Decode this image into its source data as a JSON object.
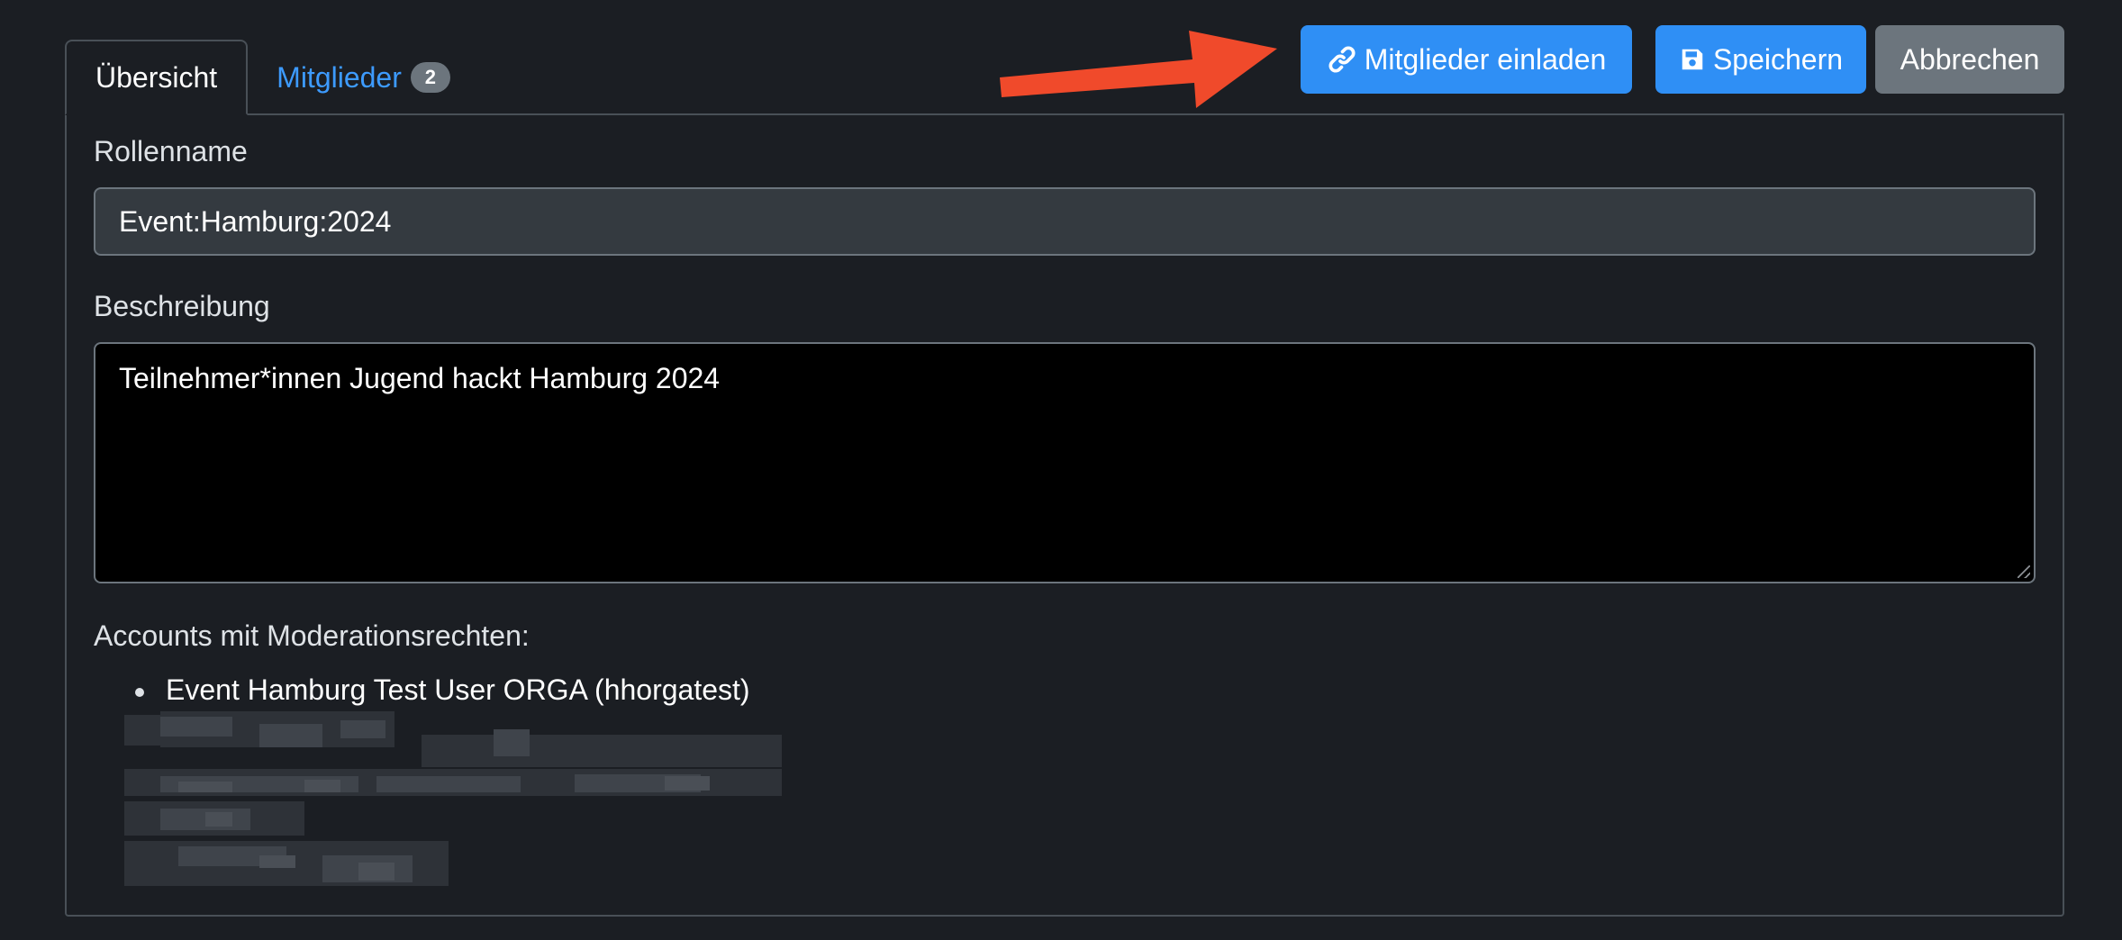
{
  "tabs": [
    {
      "label": "Übersicht",
      "active": true
    },
    {
      "label": "Mitglieder",
      "badge": "2",
      "active": false
    }
  ],
  "toolbar": {
    "invite_label": "Mitglieder einladen",
    "save_label": "Speichern",
    "cancel_label": "Abbrechen"
  },
  "form": {
    "role_name_label": "Rollenname",
    "role_name_value": "Event:Hamburg:2024",
    "description_label": "Beschreibung",
    "description_value": "Teilnehmer*innen Jugend hackt Hamburg 2024"
  },
  "moderators": {
    "heading": "Accounts mit Moderationsrechten:",
    "items": [
      "Event Hamburg Test User ORGA (hhorgatest)"
    ]
  },
  "colors": {
    "background": "#1b1e23",
    "primary": "#2f8ff5",
    "secondary": "#6c757d",
    "link": "#3d9bff",
    "annotation_arrow": "#f04a2b"
  },
  "icons": {
    "invite": "link-icon",
    "save": "floppy-disk-icon"
  }
}
